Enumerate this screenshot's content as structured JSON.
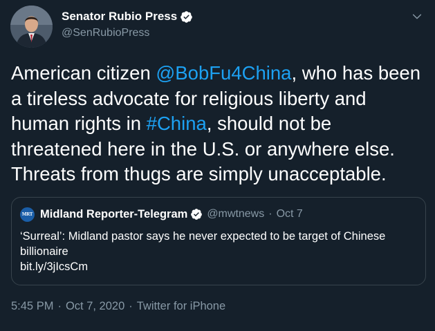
{
  "author": {
    "display_name": "Senator Rubio Press",
    "handle": "@SenRubioPress"
  },
  "tweet": {
    "text_parts": [
      {
        "text": "American citizen ",
        "link": false
      },
      {
        "text": "@BobFu4China",
        "link": true
      },
      {
        "text": ", who has been a tireless advocate for religious liberty and human rights in ",
        "link": false
      },
      {
        "text": "#China",
        "link": true
      },
      {
        "text": ", should not be threatened here in the U.S. or anywhere else. Threats from thugs are simply unacceptable.",
        "link": false
      }
    ]
  },
  "quote": {
    "logo_text": "MRT",
    "display_name": "Midland Reporter-Telegram",
    "handle": "@mwtnews",
    "separator": "·",
    "date": "Oct 7",
    "text_line1": "‘Surreal’: Midland pastor says he never expected to be target of Chinese billionaire",
    "text_line2": "bit.ly/3jIcsCm"
  },
  "meta": {
    "time": "5:45 PM",
    "separator": "·",
    "date": "Oct 7, 2020",
    "source": "Twitter for iPhone"
  },
  "icons": {
    "verified": "verified-badge-icon",
    "caret": "chevron-down-icon"
  },
  "colors": {
    "background": "#15202b",
    "link": "#1da1f2",
    "secondary_text": "#8899a6",
    "border": "#38444d"
  }
}
